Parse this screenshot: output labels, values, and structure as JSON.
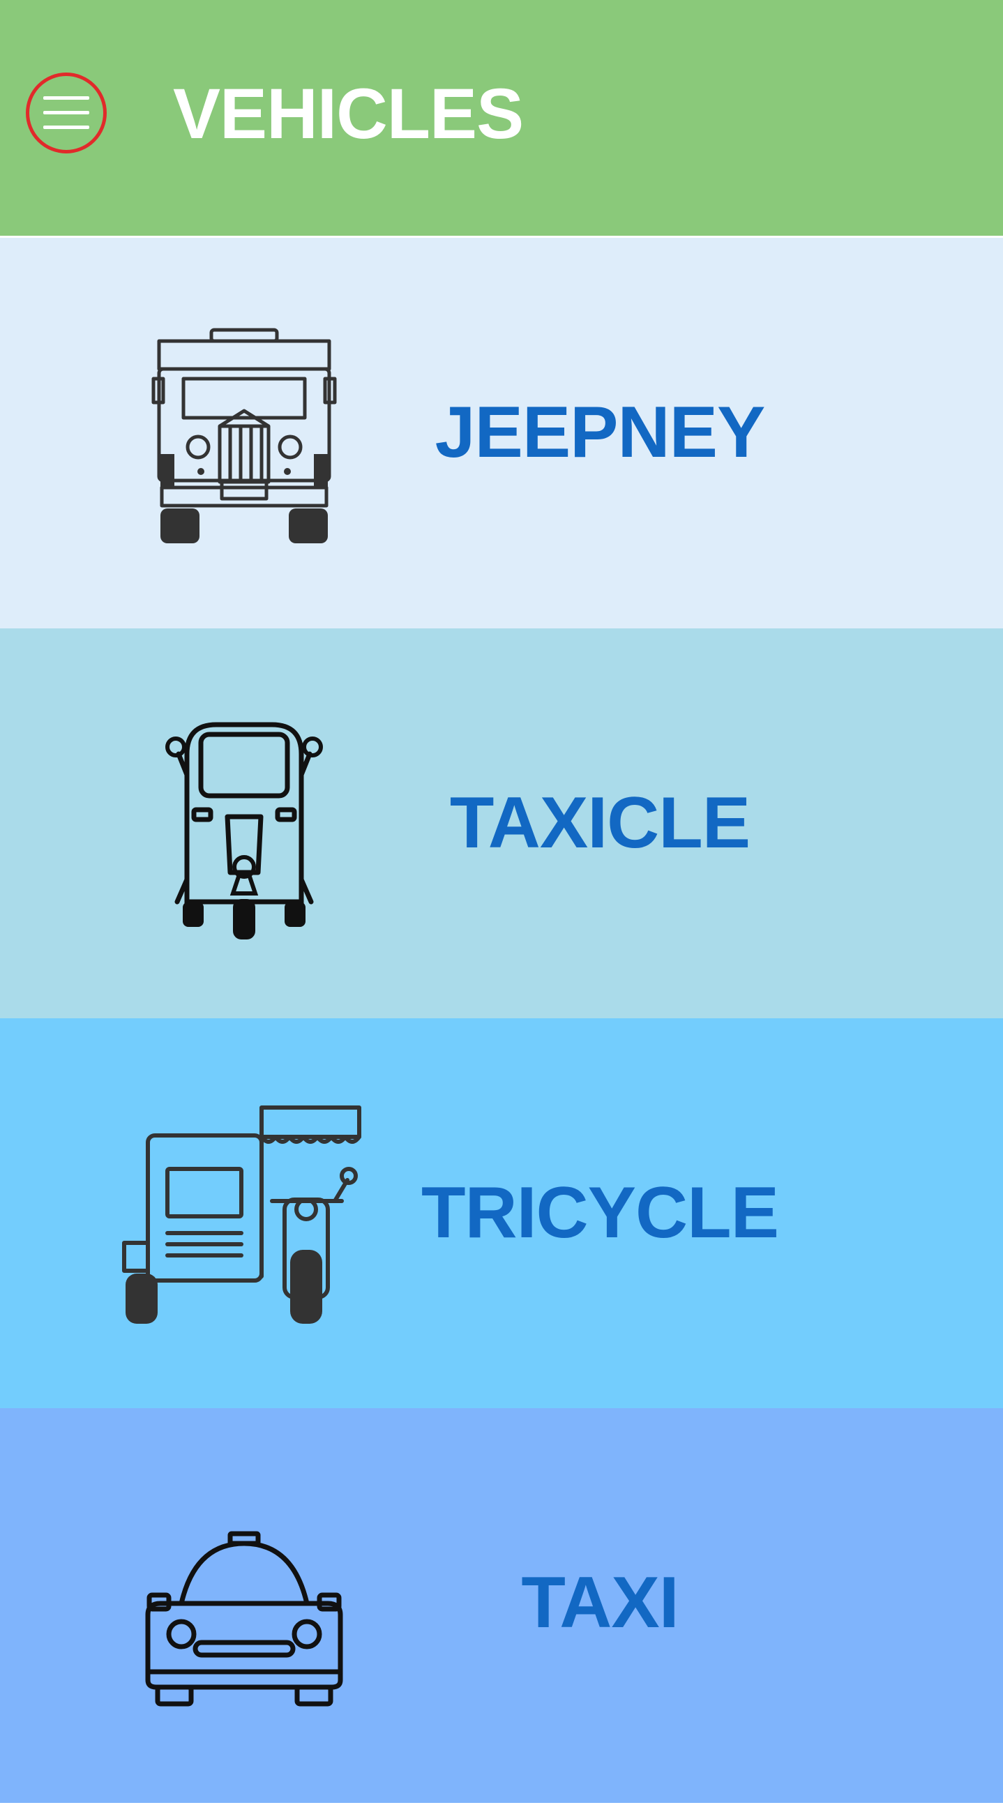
{
  "header": {
    "title": "VEHICLES",
    "background": "#8ac97a",
    "menu_icon": "hamburger-menu-icon",
    "menu_ring_color": "#e12a2a"
  },
  "vehicles": [
    {
      "label": "JEEPNEY",
      "icon": "jeepney-icon",
      "background": "#deedfa"
    },
    {
      "label": "TAXICLE",
      "icon": "taxicle-icon",
      "background": "#aadbea"
    },
    {
      "label": "TRICYCLE",
      "icon": "tricycle-icon",
      "background": "#73cdfd"
    },
    {
      "label": "TAXI",
      "icon": "taxi-icon",
      "background": "#7fb4fc"
    }
  ],
  "label_color": "#1268c3"
}
